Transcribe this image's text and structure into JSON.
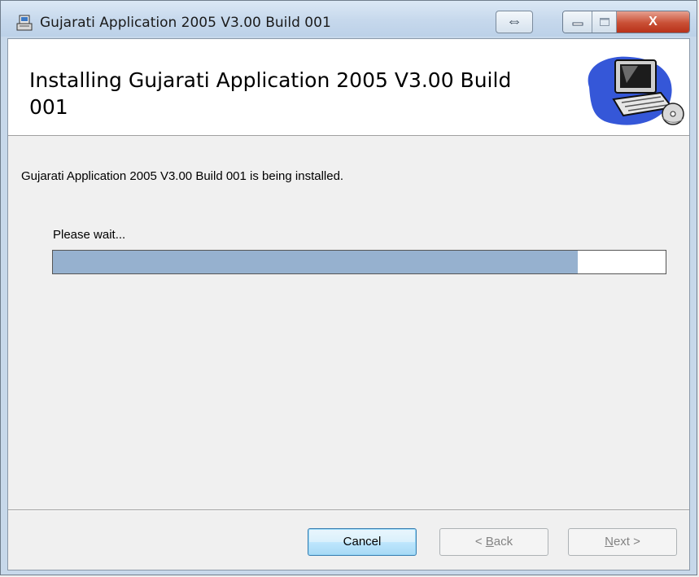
{
  "window": {
    "title": "Gujarati Application 2005 V3.00 Build 001",
    "icon": "installer-icon"
  },
  "banner": {
    "title": "Installing Gujarati Application 2005 V3.00 Build 001",
    "art": "computer-with-cd-illustration"
  },
  "body": {
    "status": "Gujarati Application 2005 V3.00 Build 001 is being installed.",
    "wait_label": "Please wait...",
    "progress": 0.857
  },
  "buttons": {
    "cancel": "Cancel",
    "back_prefix": "< ",
    "back_mnemonic": "B",
    "back_rest": "ack",
    "next_mnemonic": "N",
    "next_rest": "ext >"
  },
  "caption": {
    "resize_glyph": "⇔",
    "close_glyph": "X"
  },
  "colors": {
    "progress_fill": "#96b1cf",
    "close_red": "#c94f35"
  }
}
